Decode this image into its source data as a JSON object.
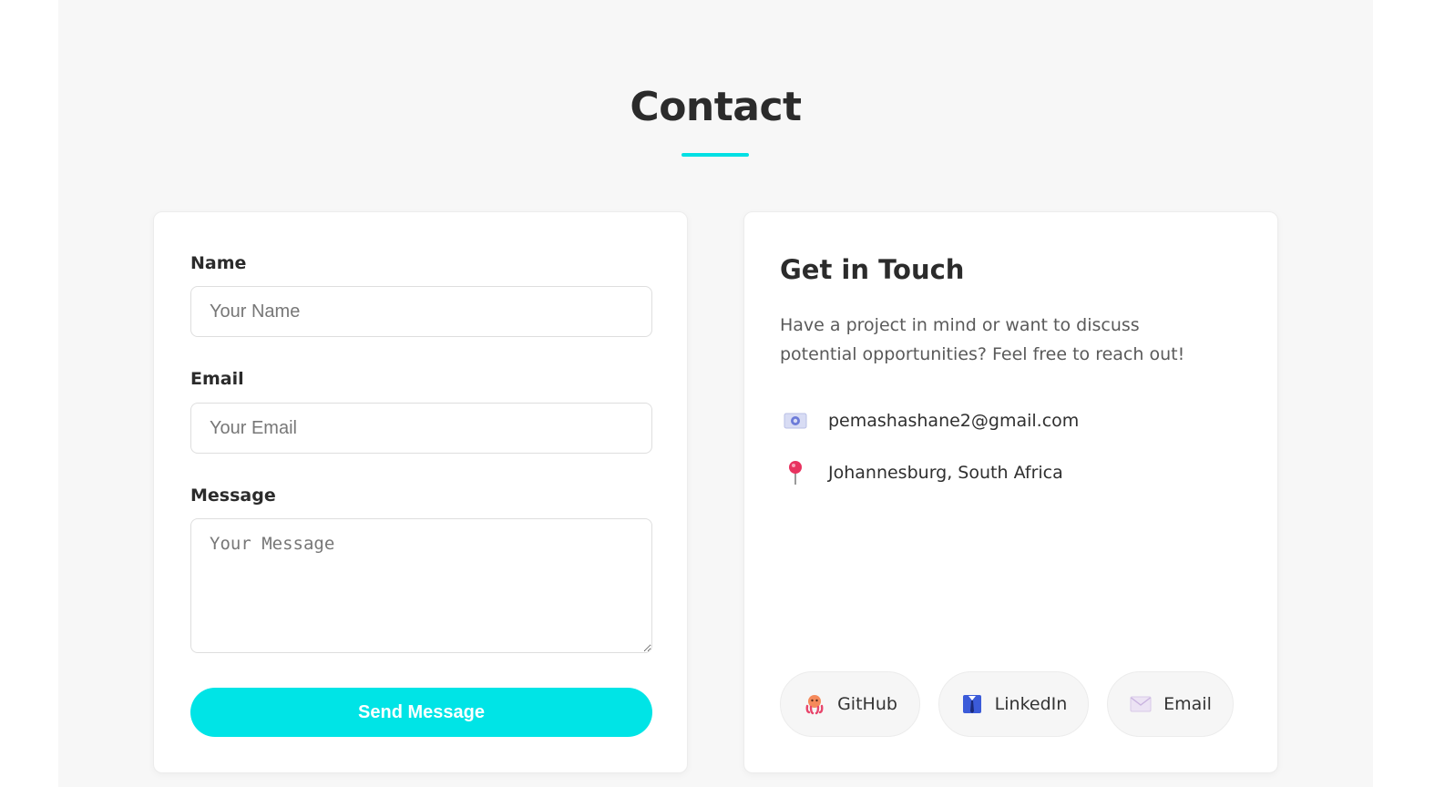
{
  "page": {
    "title": "Contact"
  },
  "form": {
    "name_label": "Name",
    "name_placeholder": "Your Name",
    "email_label": "Email",
    "email_placeholder": "Your Email",
    "message_label": "Message",
    "message_placeholder": "Your Message",
    "submit_label": "Send Message"
  },
  "info": {
    "title": "Get in Touch",
    "description": "Have a project in mind or want to discuss potential opportunities? Feel free to reach out!",
    "contacts": [
      {
        "icon": "email-icon",
        "text": "pemashashane2@gmail.com"
      },
      {
        "icon": "location-pin-icon",
        "text": "Johannesburg, South Africa"
      }
    ],
    "socials": [
      {
        "icon": "github-icon",
        "label": "GitHub"
      },
      {
        "icon": "linkedin-icon",
        "label": "LinkedIn"
      },
      {
        "icon": "envelope-icon",
        "label": "Email"
      }
    ]
  },
  "colors": {
    "accent": "#00e4e6",
    "background": "#f7f7f7"
  }
}
